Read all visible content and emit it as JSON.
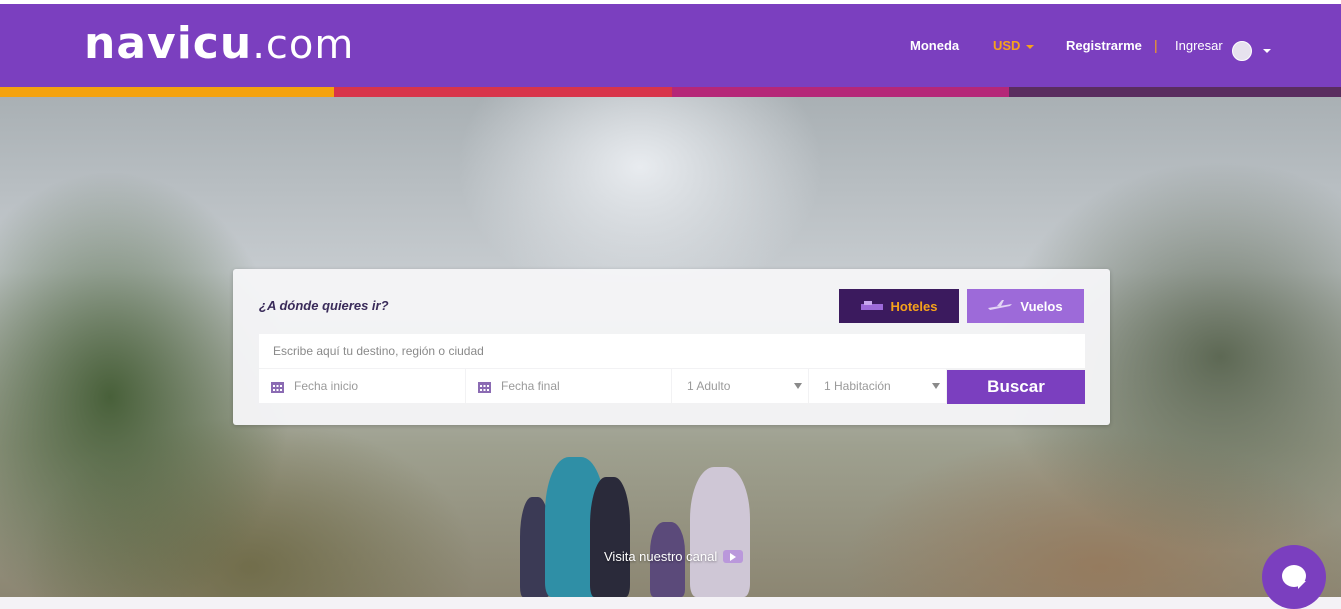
{
  "header": {
    "logo_main": "navicu",
    "logo_tld": ".com",
    "currency_label": "Moneda",
    "currency_value": "USD",
    "register": "Registrarme",
    "separator": "|",
    "login": "Ingresar"
  },
  "colors": {
    "brand_purple": "#7b3fbf",
    "accent_orange": "#f6a21b",
    "stripe": [
      "#f4a20e",
      "#d8344a",
      "#b52778",
      "#5a2d5f"
    ]
  },
  "search": {
    "question": "¿A dónde quieres ir?",
    "tabs": {
      "hotels": "Hoteles",
      "flights": "Vuelos"
    },
    "destination_placeholder": "Escribe aquí tu destino, región o ciudad",
    "start_date": "Fecha inicio",
    "end_date": "Fecha final",
    "adults": "1 Adulto",
    "rooms": "1 Habitación",
    "button": "Buscar"
  },
  "hero": {
    "channel_text": "Visita nuestro canal"
  },
  "icons": {
    "hotels": "hotel-icon",
    "flights": "plane-icon",
    "calendar": "calendar-icon",
    "chat": "chat-icon",
    "play": "play-icon",
    "avatar": "user-avatar-icon"
  }
}
